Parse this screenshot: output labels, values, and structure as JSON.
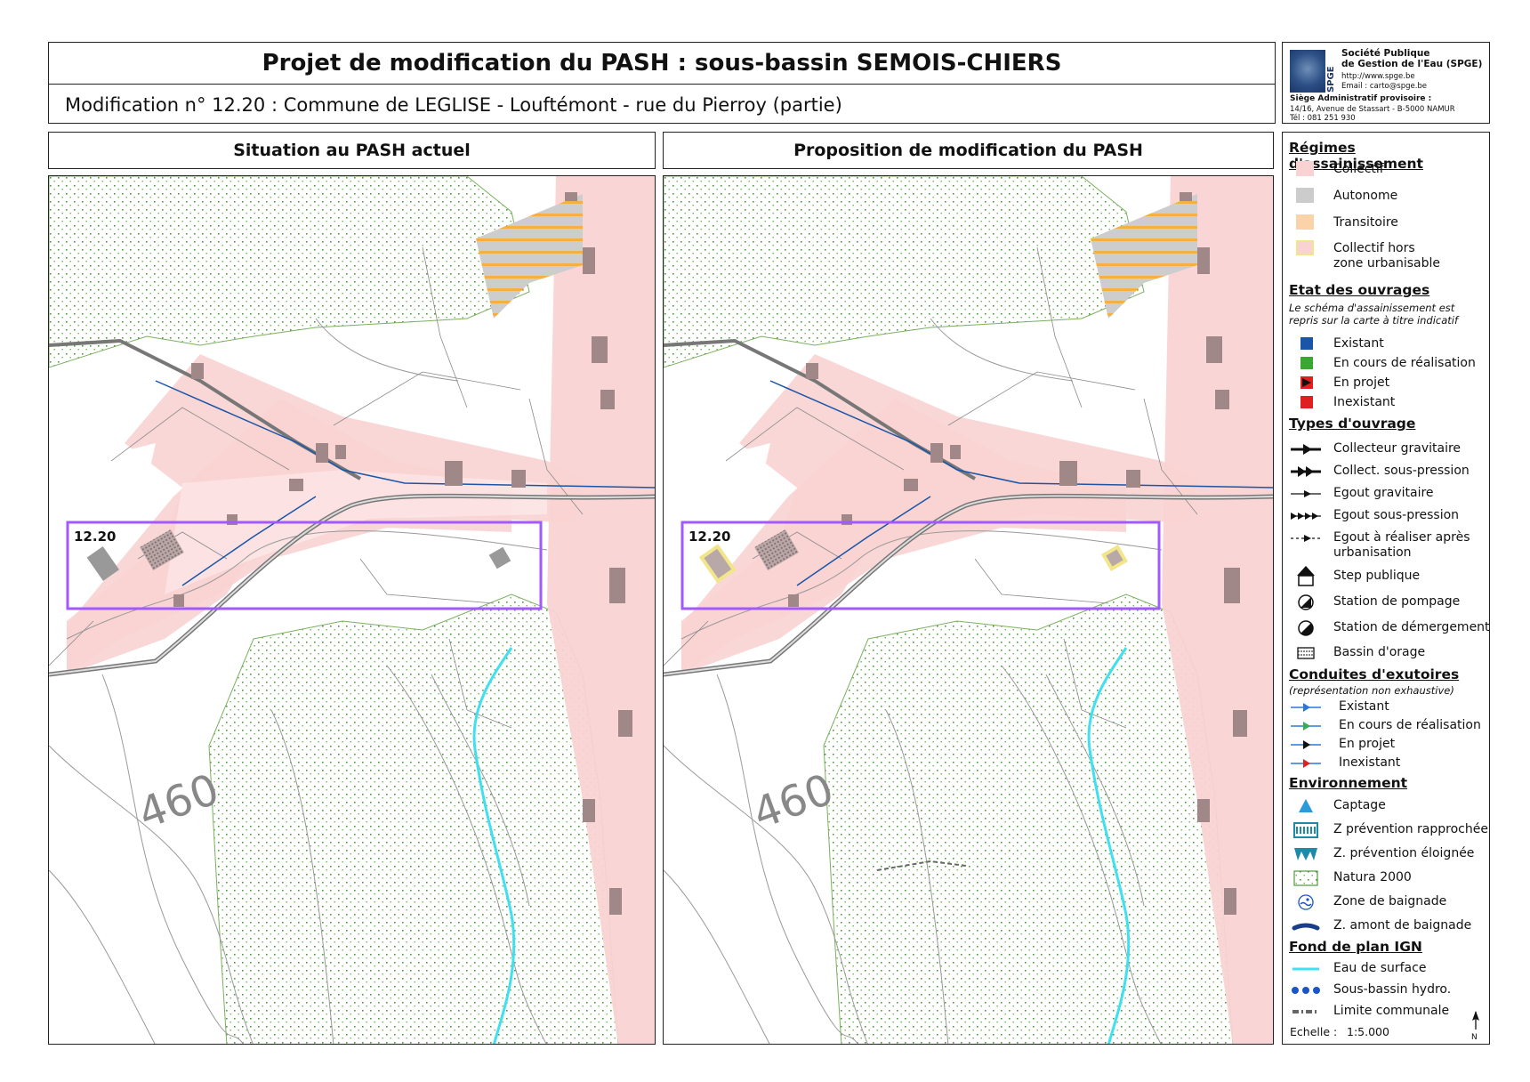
{
  "header": {
    "title": "Projet de modification du PASH : sous-bassin SEMOIS-CHIERS",
    "subtitle": "Modification n° 12.20 : Commune de LEGLISE - Louftémont - rue du Pierroy (partie)"
  },
  "logo": {
    "brand": "SPGE",
    "org_line1": "Société Publique",
    "org_line2": "de Gestion de l'Eau (SPGE)",
    "web": "http://www.spge.be",
    "email": "Email : carto@spge.be",
    "office_title": "Siège Administratif provisoire :",
    "address": "14/16, Avenue de Stassart - B-5000 NAMUR",
    "phone": "Tél : 081 251 930"
  },
  "panels": {
    "left_title": "Situation au PASH actuel",
    "right_title": "Proposition de modification du PASH",
    "zone_label": "12.20",
    "contour_label": "460"
  },
  "legend": {
    "regimes": {
      "title": "Régimes d'assainissement",
      "items": [
        {
          "label": "Collectif",
          "color": "#f9d3d3"
        },
        {
          "label": "Autonome",
          "color": "#cccccc"
        },
        {
          "label": "Transitoire",
          "color": "#fbd3a8"
        },
        {
          "label1": "Collectif hors",
          "label2": "zone urbanisable",
          "color": "#f9d3d3",
          "border": "#f3e58a"
        }
      ]
    },
    "etat": {
      "title": "Etat des ouvrages",
      "note1": "Le schéma d'assainissement est",
      "note2": "repris sur la carte à titre indicatif",
      "items": [
        {
          "label": "Existant",
          "color": "#1a55a8"
        },
        {
          "label": "En cours de réalisation",
          "color": "#3aa830"
        },
        {
          "label": "En projet",
          "color": "#111111"
        },
        {
          "label": "Inexistant",
          "color": "#e02020"
        }
      ]
    },
    "types": {
      "title": "Types d'ouvrage",
      "items": [
        {
          "label": "Collecteur gravitaire",
          "icon": "collector-gravity-icon"
        },
        {
          "label": "Collect. sous-pression",
          "icon": "collector-pressure-icon"
        },
        {
          "label": "Egout gravitaire",
          "icon": "sewer-gravity-icon"
        },
        {
          "label": "Egout sous-pression",
          "icon": "sewer-pressure-icon"
        },
        {
          "label1": "Egout à réaliser après",
          "label2": "urbanisation",
          "icon": "sewer-future-icon"
        },
        {
          "label": "Step publique",
          "icon": "treatment-plant-icon"
        },
        {
          "label": "Station de pompage",
          "icon": "pumping-station-icon"
        },
        {
          "label": "Station de démergement",
          "icon": "dewatering-station-icon"
        },
        {
          "label": "Bassin d'orage",
          "icon": "storm-basin-icon"
        }
      ]
    },
    "conduites": {
      "title": "Conduites d'exutoires",
      "note": "(représentation non exhaustive)",
      "items": [
        {
          "label": "Existant",
          "color": "#2b78d8"
        },
        {
          "label": "En cours de réalisation",
          "color": "#30b050"
        },
        {
          "label": "En projet",
          "color": "#111111"
        },
        {
          "label": "Inexistant",
          "color": "#e02020"
        }
      ]
    },
    "environnement": {
      "title": "Environnement",
      "items": [
        {
          "label": "Captage",
          "icon": "water-catchment-icon"
        },
        {
          "label": "Z prévention rapprochée",
          "icon": "close-prevention-zone-icon"
        },
        {
          "label": "Z. prévention éloignée",
          "icon": "far-prevention-zone-icon"
        },
        {
          "label": "Natura 2000",
          "icon": "natura-2000-icon"
        },
        {
          "label": "Zone de baignade",
          "icon": "bathing-zone-icon"
        },
        {
          "label": "Z. amont de baignade",
          "icon": "upstream-bathing-zone-icon"
        }
      ]
    },
    "fond": {
      "title": "Fond de plan IGN",
      "items": [
        {
          "label": "Eau de surface",
          "color": "#40e0f0"
        },
        {
          "label": "Sous-bassin hydro.",
          "color": "#1a55c8"
        },
        {
          "label": "Limite communale",
          "color": "#666666"
        }
      ]
    },
    "scale_label": "Echelle :",
    "scale_value": "1:5.000",
    "north": "N"
  }
}
